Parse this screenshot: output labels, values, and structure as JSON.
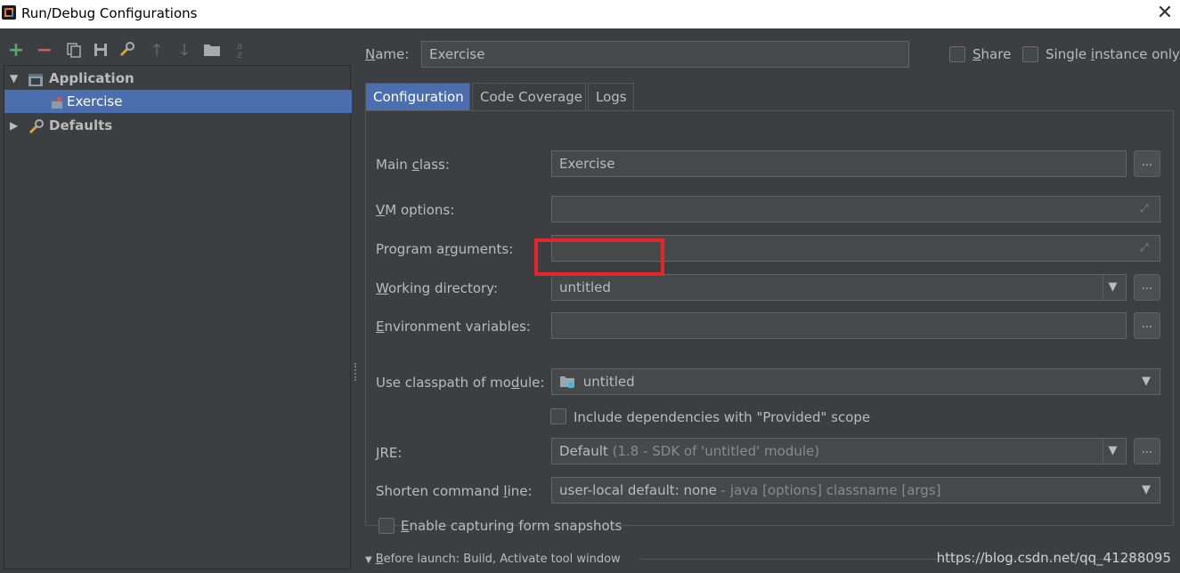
{
  "window": {
    "title": "Run/Debug Configurations",
    "close_icon": "close-icon"
  },
  "toolbar": {
    "icons": [
      "add-icon",
      "remove-icon",
      "copy-icon",
      "save-icon",
      "edit-defaults-icon",
      "move-up-icon",
      "move-down-icon",
      "folder-icon",
      "sort-icon"
    ],
    "colors": {
      "add": "#59a869",
      "remove": "#e05555"
    }
  },
  "tree": {
    "application": "Application",
    "exercise": "Exercise",
    "defaults": "Defaults"
  },
  "form": {
    "name_label_u": "N",
    "name_label_rest": "ame:",
    "name_value": "Exercise",
    "share_u": "S",
    "share_rest": "hare",
    "single_pre": "Single ",
    "single_u": "i",
    "single_rest": "nstance only"
  },
  "tabs": [
    {
      "label": "Configuration",
      "active": true
    },
    {
      "label": "Code Coverage",
      "active": false
    },
    {
      "label": "Logs",
      "active": false
    }
  ],
  "config": {
    "main_class_pre": "Main ",
    "main_class_u": "c",
    "main_class_rest": "lass:",
    "main_class_value": "Exercise",
    "vm_u": "V",
    "vm_rest": "M options:",
    "prog_pre": "Program a",
    "prog_u": "r",
    "prog_rest": "guments:",
    "wd_u": "W",
    "wd_rest": "orking directory:",
    "wd_value": "untitled",
    "env_u": "E",
    "env_rest": "nvironment variables:",
    "classpath_pre": "Use classpath of mo",
    "classpath_u": "d",
    "classpath_rest": "ule:",
    "classpath_value": "untitled",
    "include_deps": "Include dependencies with \"Provided\" scope",
    "jre_u": "J",
    "jre_rest": "RE:",
    "jre_value": "Default",
    "jre_detail": "(1.8 - SDK of 'untitled' module)",
    "shorten_pre": "Shorten command ",
    "shorten_u": "l",
    "shorten_rest": "ine:",
    "shorten_value": "user-local default: none",
    "shorten_detail": "- java [options] classname [args]",
    "snapshots_u": "E",
    "snapshots_rest": "nable capturing form snapshots",
    "dots": "...",
    "dropdown_glyph": "▼"
  },
  "before_launch": {
    "u": "B",
    "rest": "efore launch: Build, Activate tool window"
  },
  "watermark": "https://blog.csdn.net/qq_41288095"
}
